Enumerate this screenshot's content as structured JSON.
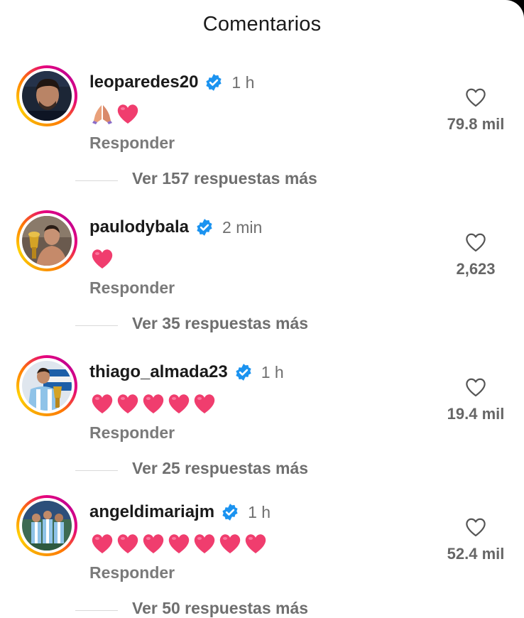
{
  "header": {
    "title": "Comentarios"
  },
  "comments": [
    {
      "username": "leoparedes20",
      "verified": true,
      "time": "1 h",
      "emojis": [
        "folded-hands-icon",
        "pink-heart-icon"
      ],
      "reply_label": "Responder",
      "likes": "79.8 mil",
      "more_replies": "Ver 157 respuestas más"
    },
    {
      "username": "paulodybala",
      "verified": true,
      "time": "2 min",
      "emojis": [
        "pink-heart-icon"
      ],
      "reply_label": "Responder",
      "likes": "2,623",
      "more_replies": "Ver 35 respuestas más"
    },
    {
      "username": "thiago_almada23",
      "verified": true,
      "time": "1 h",
      "emojis": [
        "pink-heart-icon",
        "pink-heart-icon",
        "pink-heart-icon",
        "pink-heart-icon",
        "pink-heart-icon"
      ],
      "reply_label": "Responder",
      "likes": "19.4 mil",
      "more_replies": "Ver 25 respuestas más"
    },
    {
      "username": "angeldimariajm",
      "verified": true,
      "time": "1 h",
      "emojis": [
        "pink-heart-icon",
        "pink-heart-icon",
        "pink-heart-icon",
        "pink-heart-icon",
        "pink-heart-icon",
        "pink-heart-icon",
        "pink-heart-icon"
      ],
      "reply_label": "Responder",
      "likes": "52.4 mil",
      "more_replies": "Ver 50 respuestas más"
    }
  ],
  "colors": {
    "verified": "#1b93f0",
    "heart": "#f03d6e",
    "text_primary": "#1a1a1a",
    "text_secondary": "#6f6f6f"
  }
}
